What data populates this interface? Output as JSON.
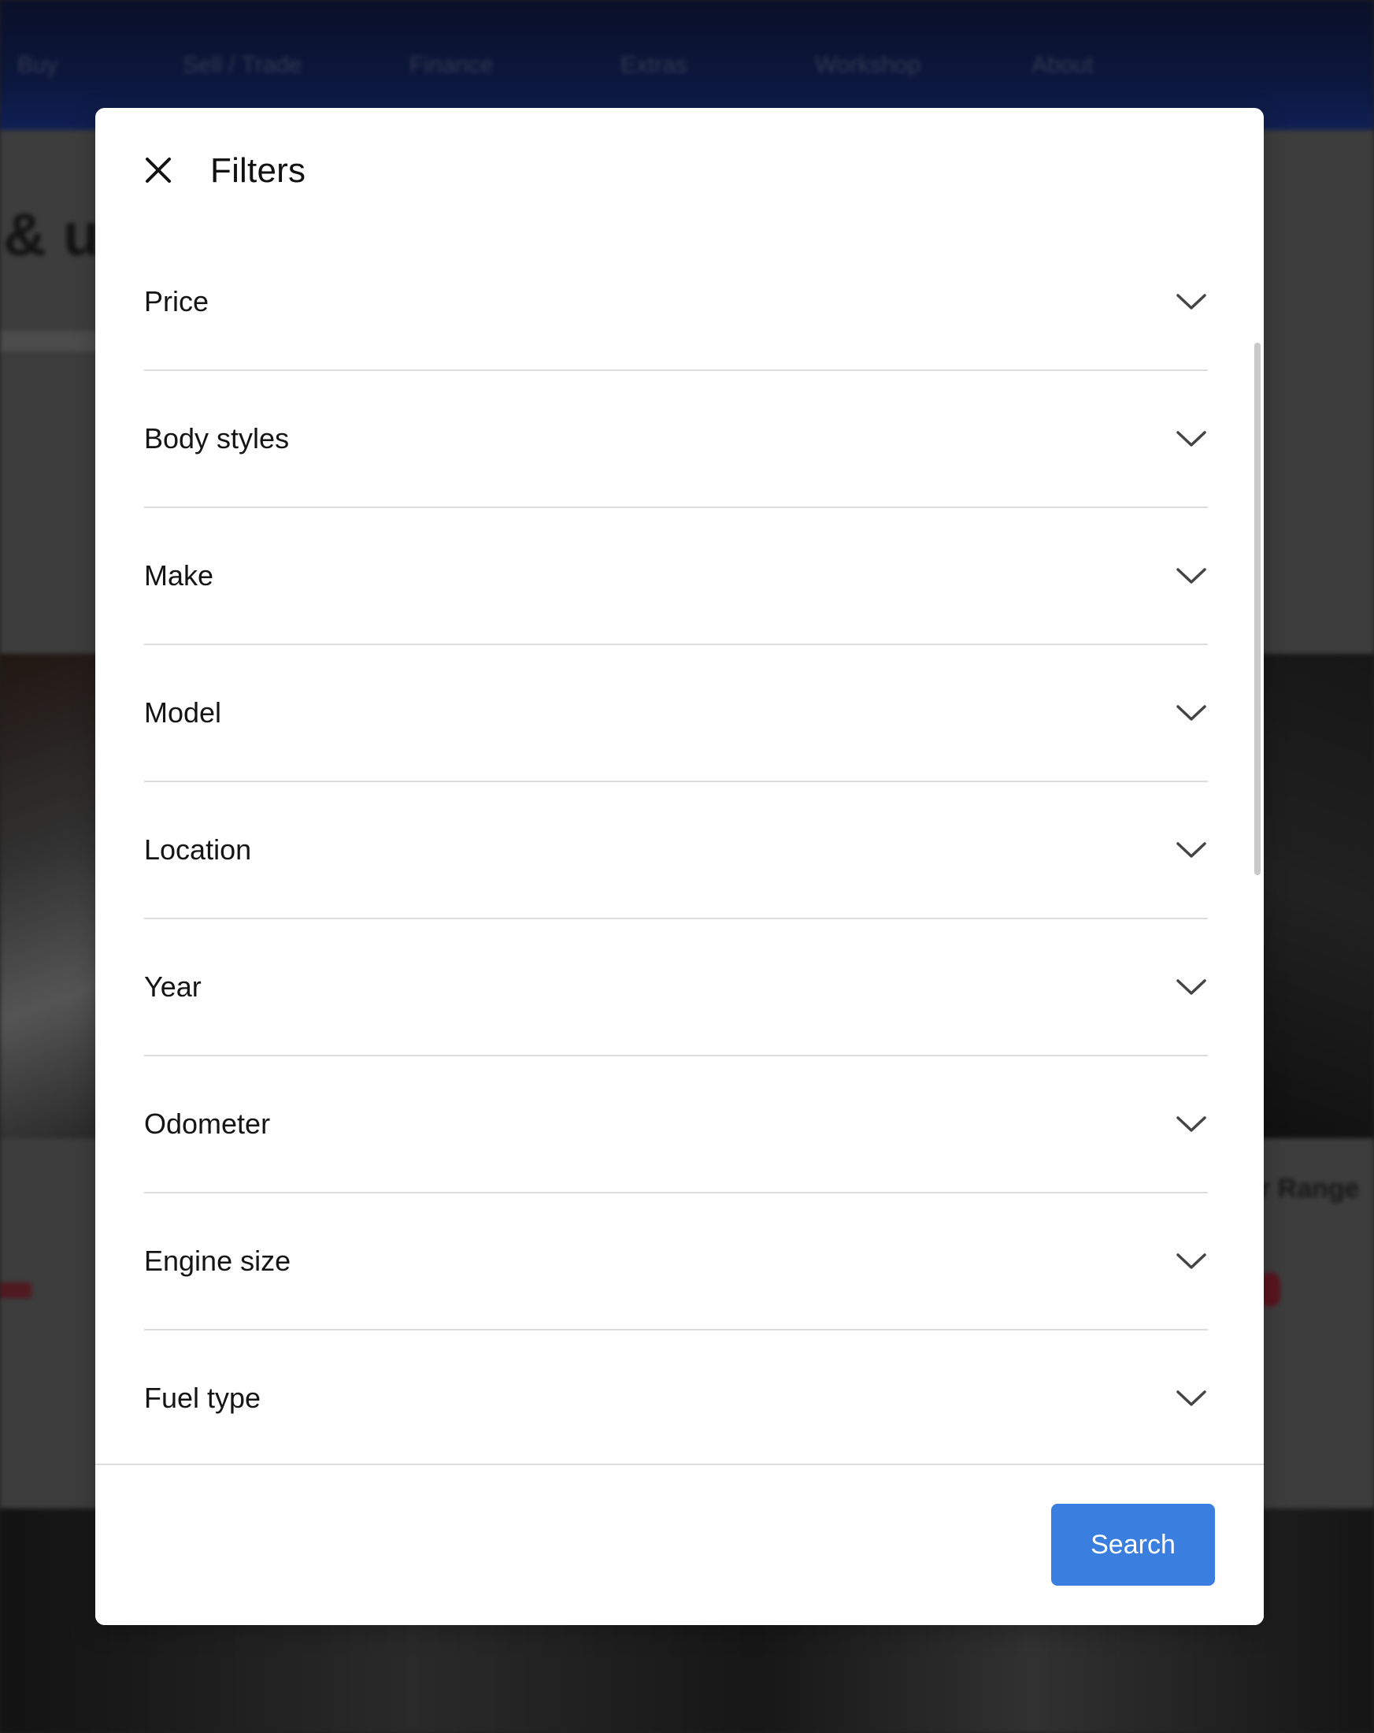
{
  "background": {
    "nav_items": [
      "Buy",
      "Sell / Trade",
      "Finance",
      "Extras",
      "Workshop",
      "About"
    ]
  },
  "modal": {
    "title": "Filters",
    "close_icon": "close-icon",
    "filters": [
      {
        "label": "Price",
        "icon": "chevron-down-icon"
      },
      {
        "label": "Body styles",
        "icon": "chevron-down-icon"
      },
      {
        "label": "Make",
        "icon": "chevron-down-icon"
      },
      {
        "label": "Model",
        "icon": "chevron-down-icon"
      },
      {
        "label": "Location",
        "icon": "chevron-down-icon"
      },
      {
        "label": "Year",
        "icon": "chevron-down-icon"
      },
      {
        "label": "Odometer",
        "icon": "chevron-down-icon"
      },
      {
        "label": "Engine size",
        "icon": "chevron-down-icon"
      },
      {
        "label": "Fuel type",
        "icon": "chevron-down-icon"
      }
    ],
    "search_label": "Search"
  },
  "colors": {
    "accent": "#3a7ee0",
    "nav_bg": "#172a6e",
    "divider": "#dcdcdc",
    "text": "#151515"
  }
}
